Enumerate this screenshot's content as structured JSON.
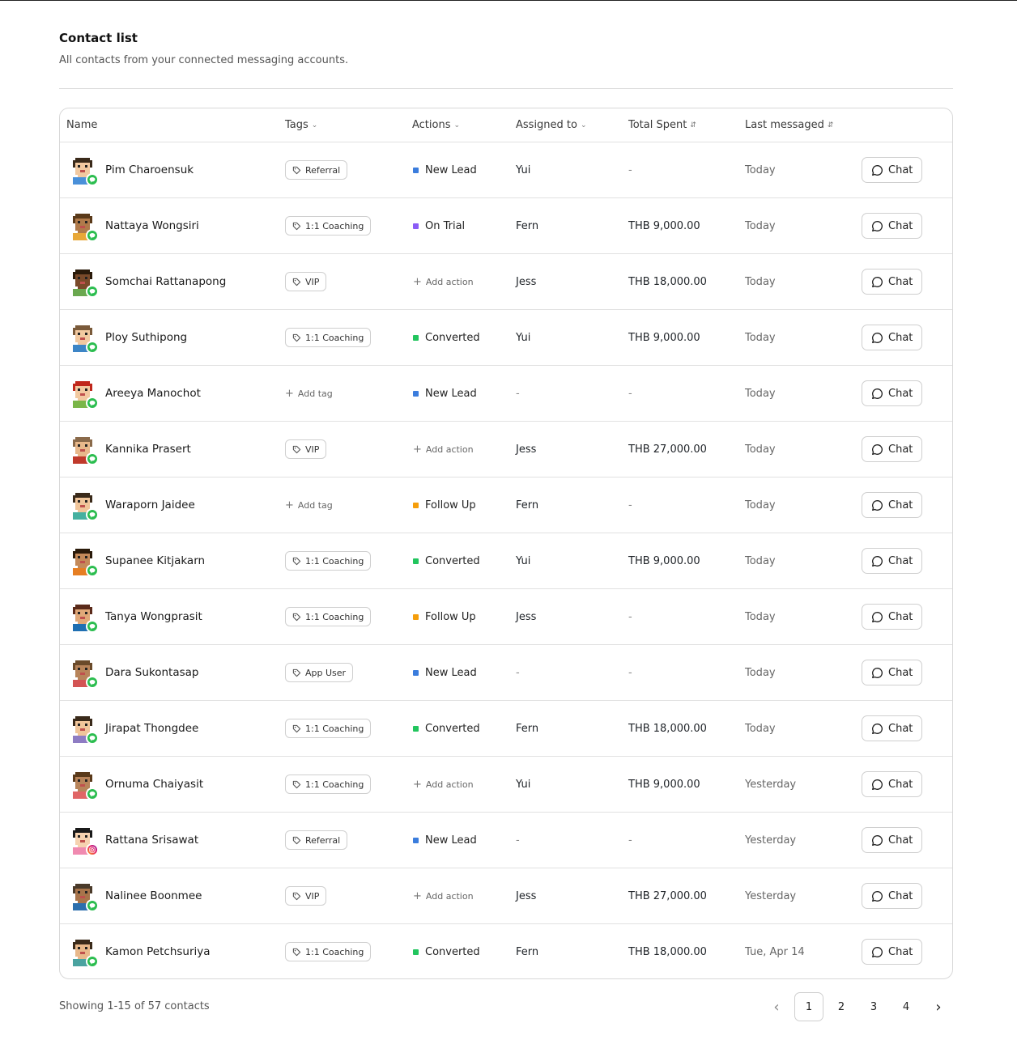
{
  "header": {
    "title": "Contact list",
    "subtitle": "All contacts from your connected messaging accounts."
  },
  "columns": {
    "name": "Name",
    "tags": "Tags",
    "actions": "Actions",
    "assigned": "Assigned to",
    "spent": "Total Spent",
    "last": "Last messaged"
  },
  "icons": {
    "tag": "tag-icon",
    "chat": "message-circle-icon",
    "line_channel": "line-icon",
    "instagram_channel": "instagram-icon",
    "add": "plus-icon",
    "prev": "chevron-left-icon",
    "next": "chevron-right-icon"
  },
  "colors": {
    "new_lead": "#3b7ddd",
    "on_trial": "#8b5cf6",
    "converted": "#22c55e",
    "follow_up": "#f59e0b",
    "line": "#2bbd4f"
  },
  "rows": [
    {
      "name": "Pim Charoensuk",
      "channel": "line",
      "tag": "Referral",
      "action": "New Lead",
      "action_type": "new_lead",
      "assigned": "Yui",
      "spent": "-",
      "last": "Today",
      "chat": "Chat"
    },
    {
      "name": "Nattaya Wongsiri",
      "channel": "line",
      "tag": "1:1 Coaching",
      "action": "On Trial",
      "action_type": "on_trial",
      "assigned": "Fern",
      "spent": "THB 9,000.00",
      "last": "Today",
      "chat": "Chat"
    },
    {
      "name": "Somchai Rattanapong",
      "channel": "line",
      "tag": "VIP",
      "action": "Add action",
      "action_type": "add",
      "assigned": "Jess",
      "spent": "THB 18,000.00",
      "last": "Today",
      "chat": "Chat"
    },
    {
      "name": "Ploy Suthipong",
      "channel": "line",
      "tag": "1:1 Coaching",
      "action": "Converted",
      "action_type": "converted",
      "assigned": "Yui",
      "spent": "THB 9,000.00",
      "last": "Today",
      "chat": "Chat"
    },
    {
      "name": "Areeya Manochot",
      "channel": "line",
      "tag": "Add tag",
      "tag_type": "add",
      "action": "New Lead",
      "action_type": "new_lead",
      "assigned": "-",
      "spent": "-",
      "last": "Today",
      "chat": "Chat"
    },
    {
      "name": "Kannika Prasert",
      "channel": "line",
      "tag": "VIP",
      "action": "Add action",
      "action_type": "add",
      "assigned": "Jess",
      "spent": "THB 27,000.00",
      "last": "Today",
      "chat": "Chat"
    },
    {
      "name": "Waraporn Jaidee",
      "channel": "line",
      "tag": "Add tag",
      "tag_type": "add",
      "action": "Follow Up",
      "action_type": "follow_up",
      "assigned": "Fern",
      "spent": "-",
      "last": "Today",
      "chat": "Chat"
    },
    {
      "name": "Supanee Kitjakarn",
      "channel": "line",
      "tag": "1:1 Coaching",
      "action": "Converted",
      "action_type": "converted",
      "assigned": "Yui",
      "spent": "THB 9,000.00",
      "last": "Today",
      "chat": "Chat"
    },
    {
      "name": "Tanya Wongprasit",
      "channel": "line",
      "tag": "1:1 Coaching",
      "action": "Follow Up",
      "action_type": "follow_up",
      "assigned": "Jess",
      "spent": "-",
      "last": "Today",
      "chat": "Chat"
    },
    {
      "name": "Dara Sukontasap",
      "channel": "line",
      "tag": "App User",
      "action": "New Lead",
      "action_type": "new_lead",
      "assigned": "-",
      "spent": "-",
      "last": "Today",
      "chat": "Chat"
    },
    {
      "name": "Jirapat Thongdee",
      "channel": "line",
      "tag": "1:1 Coaching",
      "action": "Converted",
      "action_type": "converted",
      "assigned": "Fern",
      "spent": "THB 18,000.00",
      "last": "Today",
      "chat": "Chat"
    },
    {
      "name": "Ornuma Chaiyasit",
      "channel": "line",
      "tag": "1:1 Coaching",
      "action": "Add action",
      "action_type": "add",
      "assigned": "Yui",
      "spent": "THB 9,000.00",
      "last": "Yesterday",
      "chat": "Chat"
    },
    {
      "name": "Rattana Srisawat",
      "channel": "instagram",
      "tag": "Referral",
      "action": "New Lead",
      "action_type": "new_lead",
      "assigned": "-",
      "spent": "-",
      "last": "Yesterday",
      "chat": "Chat"
    },
    {
      "name": "Nalinee Boonmee",
      "channel": "line",
      "tag": "VIP",
      "action": "Add action",
      "action_type": "add",
      "assigned": "Jess",
      "spent": "THB 27,000.00",
      "last": "Yesterday",
      "chat": "Chat"
    },
    {
      "name": "Kamon Petchsuriya",
      "channel": "line",
      "tag": "1:1 Coaching",
      "action": "Converted",
      "action_type": "converted",
      "assigned": "Fern",
      "spent": "THB 18,000.00",
      "last": "Tue, Apr 14",
      "chat": "Chat"
    }
  ],
  "footer": {
    "showing": "Showing 1-15 of 57 contacts",
    "pages": [
      "1",
      "2",
      "3",
      "4"
    ],
    "current_page": "1"
  }
}
